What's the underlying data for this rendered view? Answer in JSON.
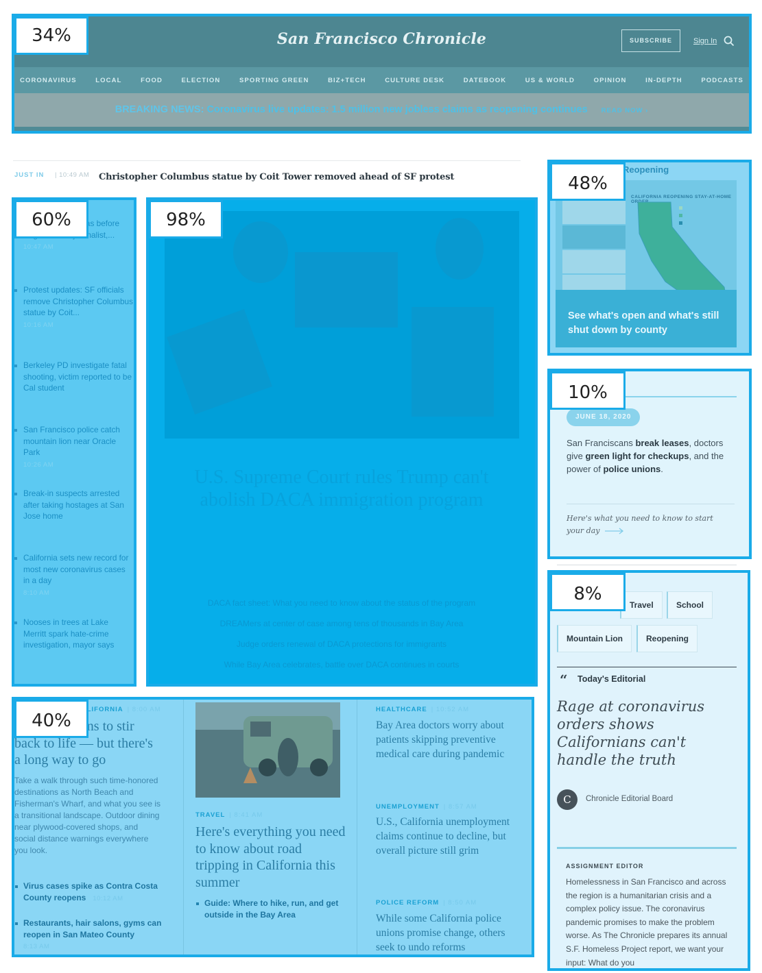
{
  "header": {
    "logo": "San Francisco Chronicle",
    "subscribe": "SUBSCRIBE",
    "sign_in": "Sign In",
    "nav": [
      "CORONAVIRUS",
      "LOCAL",
      "FOOD",
      "ELECTION",
      "SPORTING GREEN",
      "BIZ+TECH",
      "CULTURE DESK",
      "DATEBOOK",
      "US & WORLD",
      "OPINION",
      "IN-DEPTH",
      "PODCASTS"
    ],
    "breaking_label": "BREAKING NEWS:",
    "breaking_text": "Coronavirus live updates: 1.5 million new jobless claims as reopening continues",
    "read_now": "READ NOW"
  },
  "just_in": {
    "label": "JUST IN",
    "time": "10:49 AM",
    "headline": "Christopher Columbus statue by Coit Tower removed ahead of SF protest"
  },
  "left_list": [
    {
      "title": "... off body cameras before illegal raid on journalist,...",
      "time": "10:47 AM"
    },
    {
      "title": "Protest updates: SF officials remove Christopher Columbus statue by Coit...",
      "time": "10:16 AM"
    },
    {
      "title": "Berkeley PD investigate fatal shooting, victim reported to be Cal student",
      "time": ""
    },
    {
      "title": "San Francisco police catch mountain lion near Oracle Park",
      "time": "10:26 AM"
    },
    {
      "title": "Break-in suspects arrested after taking hostages at San Jose home",
      "time": ""
    },
    {
      "title": "California sets new record for most new coronavirus cases in a day",
      "time": "8:10 AM"
    },
    {
      "title": "Nooses in trees at Lake Merritt spark hate-crime investigation, mayor says",
      "time": ""
    }
  ],
  "main_story": {
    "headline": "U.S. Supreme Court rules Trump can't abolish DACA immigration program",
    "links": [
      "DACA fact sheet: What you need to know about the status of the program",
      "DREAMers at center of case among tens of thousands in Bay Area",
      "Judge orders renewal of DACA protections for immigrants",
      "While Bay Area celebrates, battle over DACA continues in courts"
    ]
  },
  "opening_card": {
    "title": "Reopening",
    "map_subtitle": "CALIFORNIA REOPENING STAY-AT-HOME ORDER",
    "caption": "See what's open and what's still shut down by county"
  },
  "newsletter": {
    "date": "JUNE 18, 2020",
    "text_parts": [
      {
        "t": "San Franciscans ",
        "b": false
      },
      {
        "t": "break leases",
        "b": true
      },
      {
        "t": ", doctors give ",
        "b": false
      },
      {
        "t": "green light for checkups",
        "b": true
      },
      {
        "t": ", and the power of ",
        "b": false
      },
      {
        "t": "police unions",
        "b": true
      },
      {
        "t": ".",
        "b": false
      }
    ],
    "footer": "Here's what you need to know to start your day"
  },
  "tags": [
    "Travel",
    "School",
    "Mountain Lion",
    "Reopening"
  ],
  "editorial": {
    "label": "Today's Editorial",
    "headline": "Rage at coronavirus orders shows Californians can't handle the truth",
    "author": "Chronicle Editorial Board",
    "avatar_letter": "C"
  },
  "assignment": {
    "label": "ASSIGNMENT EDITOR",
    "text": "Homelessness in San Francisco and across the region is a humanitarian crisis and a complex policy issue. The coronavirus pandemic promises to make the problem worse. As The Chronicle prepares its annual S.F. Homeless Project report, we want your input: What do you"
  },
  "bottom": {
    "col1": {
      "kicker": "CALIFORNIA",
      "time": "8:00 AM",
      "headline": "Tourism begins to stir back to life — but there's a long way to go",
      "dek": "Take a walk through such time-honored destinations as North Beach and Fisherman's Wharf, and what you see is a transitional landscape. Outdoor dining near plywood-covered shops, and social distance warnings everywhere you look.",
      "links": [
        {
          "title": "Virus cases spike as Contra Costa County reopens",
          "time": "10:12 AM"
        },
        {
          "title": "Restaurants, hair salons, gyms can reopen in San Mateo County",
          "time": "8:13 AM"
        }
      ]
    },
    "col2": {
      "kicker": "TRAVEL",
      "time": "8:41 AM",
      "headline": "Here's everything you need to know about road tripping in California this summer",
      "link": "Guide: Where to hike, run, and get outside in the Bay Area"
    },
    "col3": [
      {
        "kicker": "HEALTHCARE",
        "time": "10:52 AM",
        "headline": "Bay Area doctors worry about patients skipping preventive medical care during pandemic"
      },
      {
        "kicker": "UNEMPLOYMENT",
        "time": "8:57 AM",
        "headline": "U.S., California unemployment claims continue to decline, but overall picture still grim"
      },
      {
        "kicker": "POLICE REFORM",
        "time": "8:50 AM",
        "headline": "While some California police unions promise change, others seek to undo reforms"
      }
    ]
  },
  "overlays": {
    "header": "34%",
    "opening": "48%",
    "left_list": "60%",
    "main": "98%",
    "newsletter": "10%",
    "sidebar": "8%",
    "bottom": "40%"
  }
}
